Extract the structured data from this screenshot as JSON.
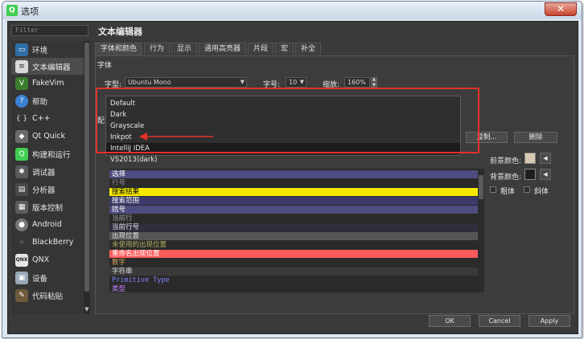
{
  "window": {
    "title": "选项",
    "close_label": "✕"
  },
  "filter": {
    "placeholder": "Filter"
  },
  "sidebar": {
    "items": [
      {
        "label": "环境",
        "icon": "monitor-icon"
      },
      {
        "label": "文本编辑器",
        "icon": "text-editor-icon",
        "selected": true
      },
      {
        "label": "FakeVim",
        "icon": "fakevim-icon"
      },
      {
        "label": "帮助",
        "icon": "help-icon"
      },
      {
        "label": "C++",
        "icon": "cpp-braces-icon"
      },
      {
        "label": "Qt Quick",
        "icon": "qt-quick-icon"
      },
      {
        "label": "构建和运行",
        "icon": "build-run-icon"
      },
      {
        "label": "调试器",
        "icon": "debugger-icon"
      },
      {
        "label": "分析器",
        "icon": "analyzer-icon"
      },
      {
        "label": "版本控制",
        "icon": "version-control-icon"
      },
      {
        "label": "Android",
        "icon": "android-icon"
      },
      {
        "label": "BlackBerry",
        "icon": "blackberry-icon"
      },
      {
        "label": "QNX",
        "icon": "qnx-icon"
      },
      {
        "label": "设备",
        "icon": "device-icon"
      },
      {
        "label": "代码粘贴",
        "icon": "code-paste-icon"
      }
    ]
  },
  "main": {
    "title": "文本编辑器",
    "tabs": [
      "字体和颜色",
      "行为",
      "显示",
      "通用高亮器",
      "片段",
      "宏",
      "补全"
    ],
    "font_section": "字体",
    "font_label": "字型:",
    "font_value": "Ubuntu Mono",
    "size_label": "字号:",
    "size_value": "10",
    "zoom_label": "缩放:",
    "zoom_value": "160%",
    "scheme_section_prefix": "配",
    "copy_button": "复制...",
    "delete_button": "删除",
    "color_scheme_options": [
      "Default",
      "Dark",
      "Grayscale",
      "Inkpot",
      "IntelliJ IDEA"
    ],
    "hovered_option": "IntelliJ IDEA",
    "preview_header": "VS2013(dark)",
    "foreground_label": "前景颜色:",
    "background_label": "背景颜色:",
    "bold_label": "粗体",
    "italic_label": "斜体",
    "foreground_color": "#d7c9b3",
    "background_color": "#1e1e1e"
  },
  "preview_rows": [
    {
      "text": "选择",
      "fg": "#ffffff",
      "bg": "#4d4d80"
    },
    {
      "text": "行号",
      "fg": "#8c8c8c",
      "bg": "#2a2a2a"
    },
    {
      "text": "搜索结果",
      "fg": "#000000",
      "bg": "#f6ea00"
    },
    {
      "text": "搜索范围",
      "fg": "#ffffff",
      "bg": "#3b3b6b"
    },
    {
      "text": "括号",
      "fg": "#ffffff",
      "bg": "#4d4d80"
    },
    {
      "text": "当前行",
      "fg": "#9c9c9c",
      "bg": "#2a2a2a"
    },
    {
      "text": "当前行号",
      "fg": "#e0e0e0",
      "bg": "#2e2e40"
    },
    {
      "text": "出现位置",
      "fg": "#e0e0e0",
      "bg": "#555555"
    },
    {
      "text": "未使用的出现位置",
      "fg": "#b0b060",
      "bg": "#2a2a2a"
    },
    {
      "text": "重命名出现位置",
      "fg": "#ffffff",
      "bg": "#ff5c5c"
    },
    {
      "text": "数字",
      "fg": "#d7a65a",
      "bg": "#2a2a2a"
    },
    {
      "text": "字符串",
      "fg": "#e0e0e0",
      "bg": "#3a3a3a"
    },
    {
      "text": "Primitive Type",
      "fg": "#7f7fff",
      "bg": "#2a2a2a"
    },
    {
      "text": "类型",
      "fg": "#c080ff",
      "bg": "#2a2a2a"
    }
  ],
  "footer": {
    "ok": "OK",
    "cancel": "Cancel",
    "apply": "Apply"
  }
}
